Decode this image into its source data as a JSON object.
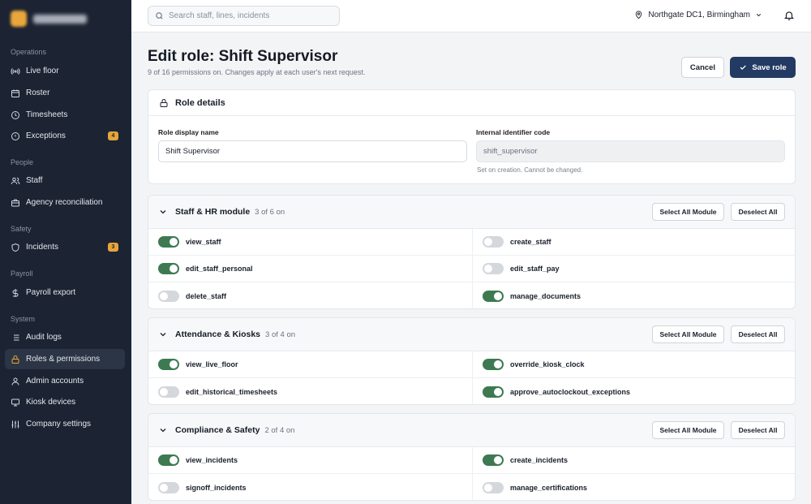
{
  "app": {
    "name": "Dockside"
  },
  "sidebar": {
    "sections": [
      "Operations",
      "People",
      "Safety",
      "Payroll",
      "System"
    ],
    "items": [
      {
        "label": "Live floor",
        "icon": "broadcast-icon"
      },
      {
        "label": "Roster",
        "icon": "calendar-icon"
      },
      {
        "label": "Timesheets",
        "icon": "clock-icon"
      },
      {
        "label": "Exceptions",
        "icon": "alert-circle-icon",
        "badge": "4"
      },
      {
        "label": "Staff",
        "icon": "users-icon"
      },
      {
        "label": "Agency reconciliation",
        "icon": "briefcase-icon"
      },
      {
        "label": "Incidents",
        "icon": "shield-icon",
        "badge": "3"
      },
      {
        "label": "Payroll export",
        "icon": "dollar-icon"
      },
      {
        "label": "Audit logs",
        "icon": "list-icon"
      },
      {
        "label": "Roles & permissions",
        "icon": "lock-icon",
        "active": true
      },
      {
        "label": "Admin accounts",
        "icon": "user-icon"
      },
      {
        "label": "Kiosk devices",
        "icon": "monitor-icon"
      },
      {
        "label": "Company settings",
        "icon": "sliders-icon"
      }
    ]
  },
  "topbar": {
    "search_placeholder": "Search staff, lines, incidents",
    "location": "Northgate DC1, Birmingham"
  },
  "page": {
    "title": "Edit role: Shift Supervisor",
    "subtitle": "9 of 16 permissions on. Changes apply at each user's next request.",
    "cancel_label": "Cancel",
    "save_label": "Save role"
  },
  "role_details": {
    "heading": "Role details",
    "display_name_label": "Role display name",
    "display_name_value": "Shift Supervisor",
    "identifier_label": "Internal identifier code",
    "identifier_value": "shift_supervisor",
    "identifier_hint": "Set on creation. Cannot be changed."
  },
  "modules": [
    {
      "name": "Staff & HR module",
      "count": "3 of 6 on",
      "select_all": "Select All Module",
      "deselect_all": "Deselect All",
      "perms": [
        {
          "name": "view_staff",
          "on": true
        },
        {
          "name": "create_staff",
          "on": false
        },
        {
          "name": "edit_staff_personal",
          "on": true
        },
        {
          "name": "edit_staff_pay",
          "on": false
        },
        {
          "name": "delete_staff",
          "on": false
        },
        {
          "name": "manage_documents",
          "on": true
        }
      ]
    },
    {
      "name": "Attendance & Kiosks",
      "count": "3 of 4 on",
      "select_all": "Select All Module",
      "deselect_all": "Deselect All",
      "perms": [
        {
          "name": "view_live_floor",
          "on": true
        },
        {
          "name": "override_kiosk_clock",
          "on": true
        },
        {
          "name": "edit_historical_timesheets",
          "on": false
        },
        {
          "name": "approve_autoclockout_exceptions",
          "on": true
        }
      ]
    },
    {
      "name": "Compliance & Safety",
      "count": "2 of 4 on",
      "select_all": "Select All Module",
      "deselect_all": "Deselect All",
      "perms": [
        {
          "name": "view_incidents",
          "on": true
        },
        {
          "name": "create_incidents",
          "on": true
        },
        {
          "name": "signoff_incidents",
          "on": false
        },
        {
          "name": "manage_certifications",
          "on": false
        }
      ]
    }
  ]
}
